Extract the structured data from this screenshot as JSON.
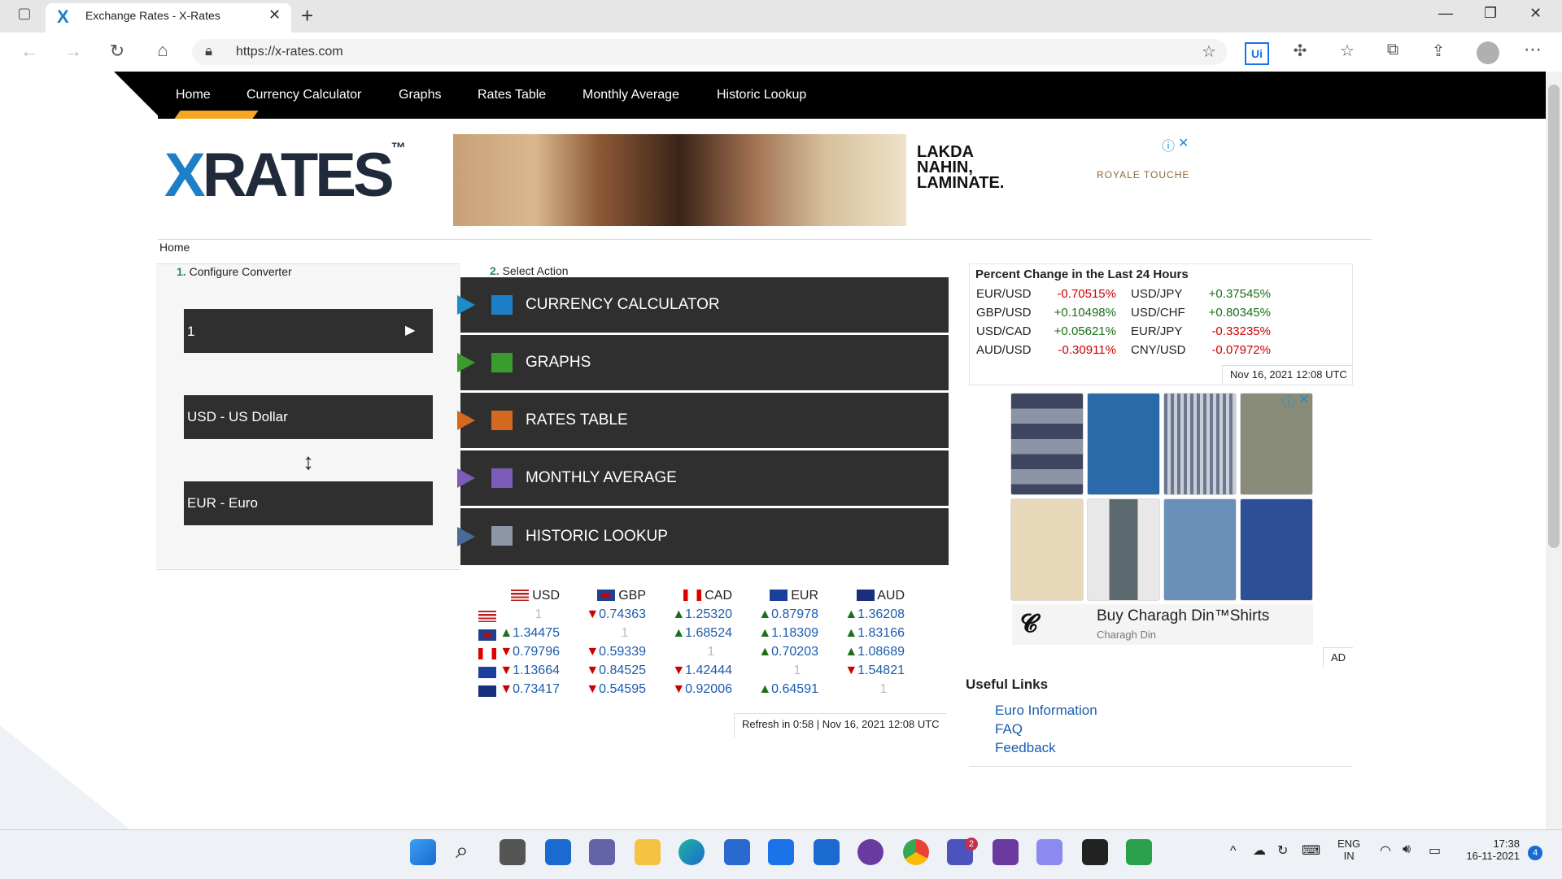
{
  "browser": {
    "tab_title": "Exchange Rates - X-Rates",
    "url": "https://x-rates.com"
  },
  "nav": {
    "items": [
      "Home",
      "Currency Calculator",
      "Graphs",
      "Rates Table",
      "Monthly Average",
      "Historic Lookup"
    ]
  },
  "logo": {
    "x": "X",
    "rest": "RATES",
    "tm": "™"
  },
  "ad_top": {
    "line1": "LAKDA",
    "line2": "NAHIN,",
    "line3": "LAMINATE.",
    "brand": "ROYALE TOUCHE"
  },
  "breadcrumb": "Home",
  "converter": {
    "step1_num": "1.",
    "step1_label": "Configure Converter",
    "amount": "1",
    "from": "USD - US Dollar",
    "to": "EUR - Euro",
    "swap_glyph": "↕"
  },
  "actions": {
    "step2_num": "2.",
    "step2_label": "Select Action",
    "items": [
      "CURRENCY CALCULATOR",
      "GRAPHS",
      "RATES TABLE",
      "MONTHLY AVERAGE",
      "HISTORIC LOOKUP"
    ]
  },
  "rates_table": {
    "headers": [
      "USD",
      "GBP",
      "CAD",
      "EUR",
      "AUD"
    ],
    "rows": [
      [
        "1",
        "▼0.74363",
        "▲1.25320",
        "▲0.87978",
        "▲1.36208"
      ],
      [
        "▲1.34475",
        "1",
        "▲1.68524",
        "▲1.18309",
        "▲1.83166"
      ],
      [
        "▼0.79796",
        "▼0.59339",
        "1",
        "▲0.70203",
        "▲1.08689"
      ],
      [
        "▼1.13664",
        "▼0.84525",
        "▼1.42444",
        "1",
        "▼1.54821"
      ],
      [
        "▼0.73417",
        "▼0.54595",
        "▼0.92006",
        "▲0.64591",
        "1"
      ]
    ],
    "footer": "Refresh in 0:58 | Nov 16, 2021 12:08 UTC"
  },
  "percent_change": {
    "title": "Percent Change in the Last 24 Hours",
    "left": [
      {
        "pair": "EUR/USD",
        "value": "-0.70515%"
      },
      {
        "pair": "GBP/USD",
        "value": "+0.10498%"
      },
      {
        "pair": "USD/CAD",
        "value": "+0.05621%"
      },
      {
        "pair": "AUD/USD",
        "value": "-0.30911%"
      }
    ],
    "right": [
      {
        "pair": "USD/JPY",
        "value": "+0.37545%"
      },
      {
        "pair": "USD/CHF",
        "value": "+0.80345%"
      },
      {
        "pair": "EUR/JPY",
        "value": "-0.33235%"
      },
      {
        "pair": "CNY/USD",
        "value": "-0.07972%"
      }
    ],
    "timestamp": "Nov 16, 2021 12:08 UTC"
  },
  "ad_side": {
    "headline": "Buy Charagh Din™Shirts",
    "advertiser": "Charagh Din",
    "badge": "AD"
  },
  "useful_links": {
    "title": "Useful Links",
    "items": [
      "Euro Information",
      "FAQ",
      "Feedback"
    ]
  },
  "taskbar": {
    "lang1": "ENG",
    "lang2": "IN",
    "time": "17:38",
    "date": "16-11-2021",
    "notif": "4",
    "teams_badge": "2"
  },
  "colors": {
    "accent": "#f5a623",
    "up": "#1b6e1b",
    "down": "#cc0000",
    "dark": "#2f2f2f"
  }
}
